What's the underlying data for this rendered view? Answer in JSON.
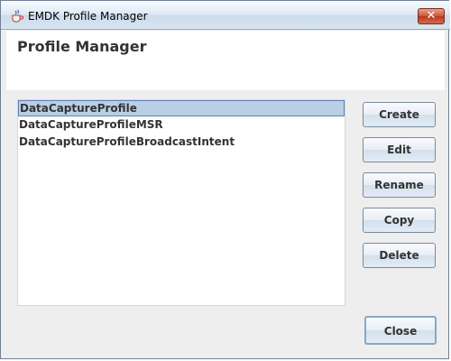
{
  "window": {
    "title": "EMDK Profile Manager",
    "close_glyph": "✕"
  },
  "header": {
    "title": "Profile Manager"
  },
  "profiles": [
    {
      "label": "DataCaptureProfile",
      "selected": true
    },
    {
      "label": "DataCaptureProfileMSR",
      "selected": false
    },
    {
      "label": "DataCaptureProfileBroadcastIntent",
      "selected": false
    }
  ],
  "actions": {
    "create": "Create",
    "edit": "Edit",
    "rename": "Rename",
    "copy": "Copy",
    "delete": "Delete"
  },
  "footer": {
    "close": "Close"
  },
  "icons": {
    "app": "java-cup-icon",
    "window_close": "close-icon"
  },
  "colors": {
    "selection": "#b8cfe5",
    "close_button": "#c9553b"
  }
}
